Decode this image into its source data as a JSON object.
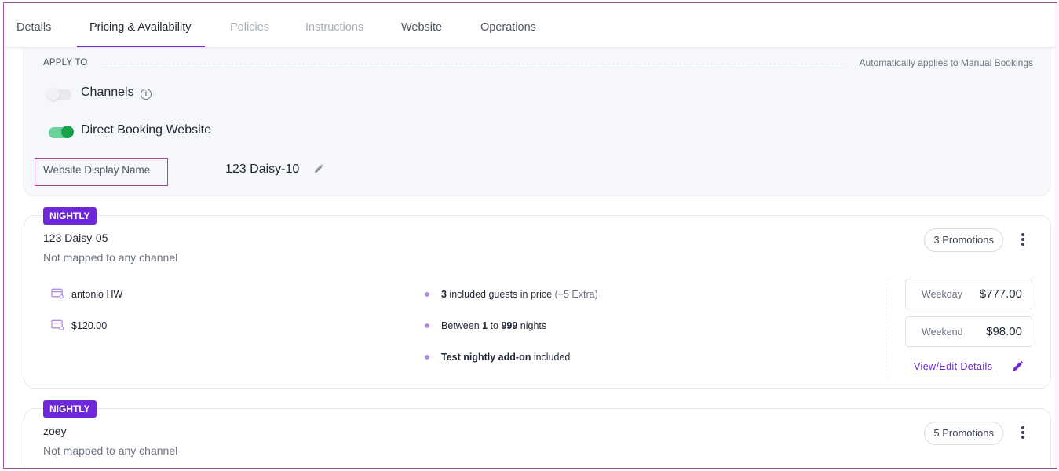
{
  "tabs": [
    {
      "label": "Details",
      "state": "normal"
    },
    {
      "label": "Pricing & Availability",
      "state": "active"
    },
    {
      "label": "Policies",
      "state": "disabled"
    },
    {
      "label": "Instructions",
      "state": "disabled"
    },
    {
      "label": "Website",
      "state": "normal"
    },
    {
      "label": "Operations",
      "state": "normal"
    }
  ],
  "apply_to": {
    "label": "APPLY TO",
    "note": "Automatically applies to Manual Bookings",
    "channels": {
      "label": "Channels",
      "enabled": false
    },
    "direct_booking": {
      "label": "Direct Booking Website",
      "enabled": true
    },
    "display_name_label": "Website Display Name",
    "display_name_value": "123 Daisy-10"
  },
  "cards": [
    {
      "badge": "NIGHTLY",
      "title": "123 Daisy-05",
      "subtitle": "Not mapped to any channel",
      "promotions": "3 Promotions",
      "meta": [
        {
          "icon": "credit-card-user-icon",
          "text": "antonio HW"
        },
        {
          "icon": "credit-card-lock-icon",
          "text": "$120.00"
        }
      ],
      "bullets": [
        {
          "strong": "3",
          "text": " included guests in price ",
          "muted": "(+5 Extra)"
        },
        {
          "pre": "Between ",
          "strong1": "1",
          "mid": " to ",
          "strong2": "999",
          "post": " nights"
        },
        {
          "strong": "Test nightly add-on",
          "text": " included"
        }
      ],
      "prices": [
        {
          "label": "Weekday",
          "value": "$777.00"
        },
        {
          "label": "Weekend",
          "value": "$98.00"
        }
      ],
      "link": "View/Edit Details"
    },
    {
      "badge": "NIGHTLY",
      "title": "zoey",
      "subtitle": "Not mapped to any channel",
      "promotions": "5 Promotions"
    }
  ],
  "colors": {
    "accent": "#6d28d9",
    "toggle_on": "#16a34a",
    "frame": "#a24ea5"
  }
}
